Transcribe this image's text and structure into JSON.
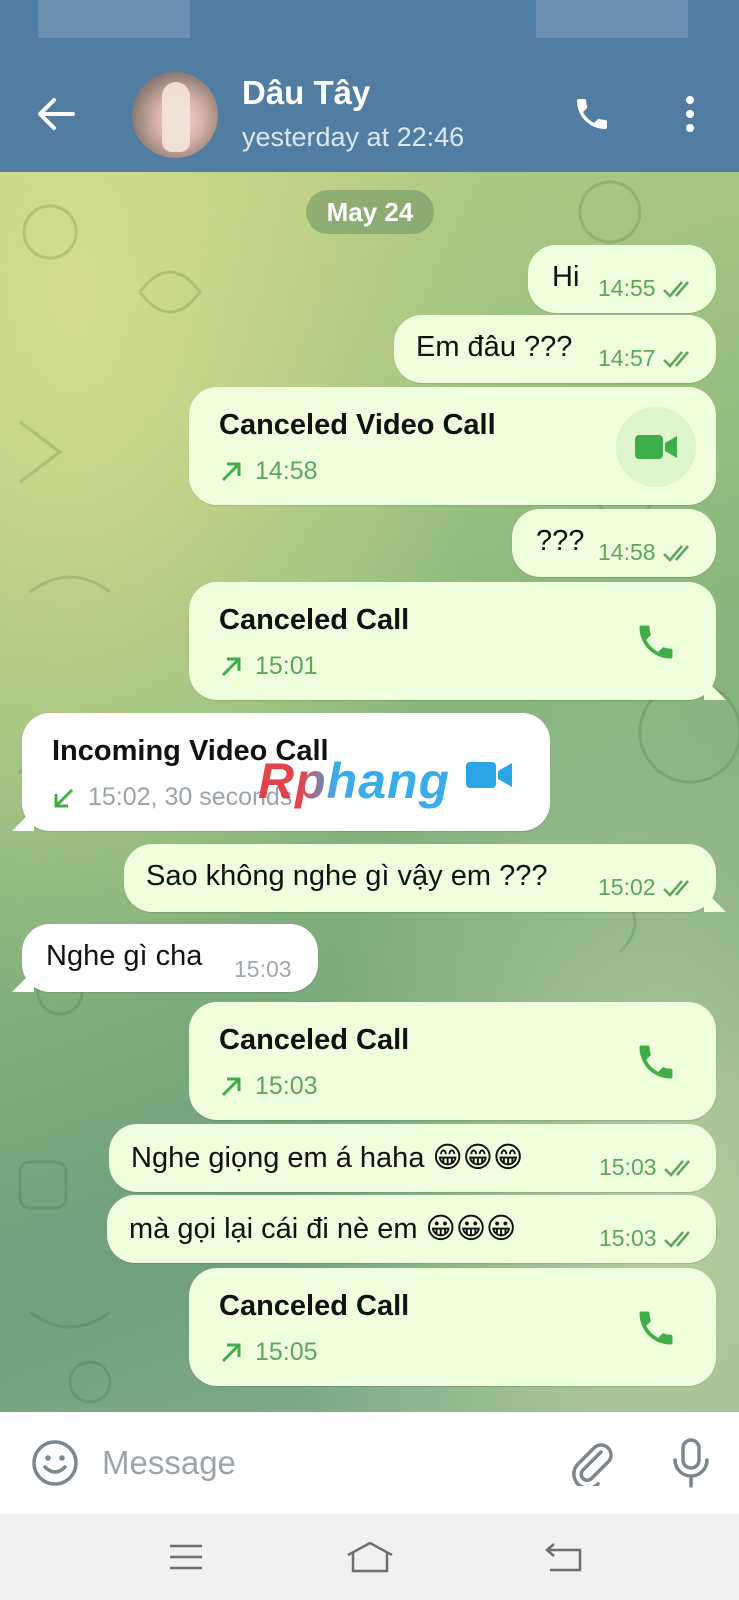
{
  "header": {
    "contact_name": "Dâu Tây",
    "last_seen": "yesterday at 22:46",
    "back_icon": "arrow-back-icon",
    "call_icon": "phone-icon",
    "more_icon": "more-vertical-icon",
    "color": "#527da3"
  },
  "chat": {
    "date": "May 24",
    "messages": [
      {
        "type": "text",
        "dir": "out",
        "text": "Hi",
        "time": "14:55",
        "read": true
      },
      {
        "type": "text",
        "dir": "out",
        "text": "Em đâu ???",
        "time": "14:57",
        "read": true
      },
      {
        "type": "call",
        "dir": "out",
        "title": "Canceled Video Call",
        "time": "14:58",
        "call_kind": "video"
      },
      {
        "type": "text",
        "dir": "out",
        "text": "???",
        "time": "14:58",
        "read": true
      },
      {
        "type": "call",
        "dir": "out",
        "title": "Canceled Call",
        "time": "15:01",
        "call_kind": "voice"
      },
      {
        "type": "call",
        "dir": "in",
        "title": "Incoming Video Call",
        "time": "15:02, 30 seconds",
        "call_kind": "video"
      },
      {
        "type": "text",
        "dir": "out",
        "text": "Sao không nghe gì vậy em ???",
        "time": "15:02",
        "read": true
      },
      {
        "type": "text",
        "dir": "in",
        "text": "Nghe gì cha",
        "time": "15:03"
      },
      {
        "type": "call",
        "dir": "out",
        "title": "Canceled Call",
        "time": "15:03",
        "call_kind": "voice"
      },
      {
        "type": "text",
        "dir": "out",
        "text": "Nghe giọng em á haha 😁😁😁",
        "time": "15:03",
        "read": true
      },
      {
        "type": "text",
        "dir": "out",
        "text": "mà gọi lại cái đi nè em 😀😀😀",
        "time": "15:03",
        "read": true
      },
      {
        "type": "call",
        "dir": "out",
        "title": "Canceled Call",
        "time": "15:05",
        "call_kind": "voice"
      }
    ]
  },
  "watermark": "Rphang",
  "composer": {
    "placeholder": "Message",
    "emoji_icon": "smiley-icon",
    "attach_icon": "paperclip-icon",
    "mic_icon": "microphone-icon"
  },
  "navigation": {
    "recent_icon": "menu-lines-icon",
    "home_icon": "home-icon",
    "back_icon": "back-icon"
  },
  "colors": {
    "outgoing_bubble": "#effedd",
    "incoming_bubble": "#ffffff",
    "accent_green": "#5fa55a"
  }
}
